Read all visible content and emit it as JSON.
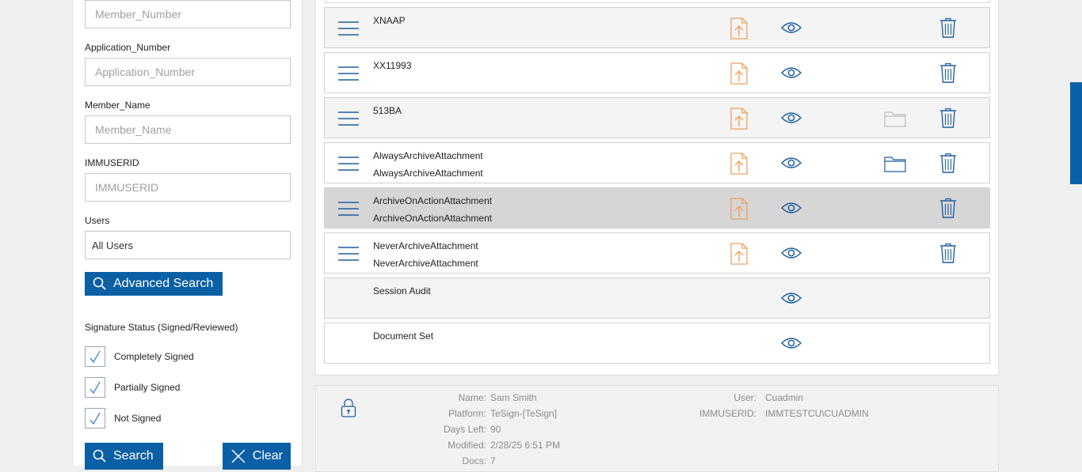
{
  "filters": {
    "member_number": {
      "placeholder": "Member_Number"
    },
    "application_number": {
      "label": "Application_Number",
      "placeholder": "Application_Number"
    },
    "member_name": {
      "label": "Member_Name",
      "placeholder": "Member_Name"
    },
    "immuserid": {
      "label": "IMMUSERID",
      "placeholder": "IMMUSERID"
    },
    "users": {
      "label": "Users",
      "value": "All Users"
    },
    "advanced_search_label": "Advanced Search",
    "signature_status": {
      "title": "Signature Status (Signed/Reviewed)",
      "options": [
        {
          "label": "Completely Signed",
          "checked": true
        },
        {
          "label": "Partially Signed",
          "checked": true
        },
        {
          "label": "Not Signed",
          "checked": true
        }
      ]
    },
    "search_label": "Search",
    "clear_label": "Clear"
  },
  "documents": [
    {
      "line1": "XNAAP",
      "line2": "",
      "menu": true,
      "upload": true,
      "view": true,
      "folder": false,
      "folder_active": false,
      "delete": true,
      "state": "alt"
    },
    {
      "line1": "XX11993",
      "line2": "",
      "menu": true,
      "upload": true,
      "view": true,
      "folder": false,
      "folder_active": false,
      "delete": true,
      "state": "normal"
    },
    {
      "line1": "513BA",
      "line2": "",
      "menu": true,
      "upload": true,
      "view": true,
      "folder": true,
      "folder_active": false,
      "delete": true,
      "state": "alt"
    },
    {
      "line1": "AlwaysArchiveAttachment",
      "line2": "AlwaysArchiveAttachment",
      "menu": true,
      "upload": true,
      "view": true,
      "folder": true,
      "folder_active": true,
      "delete": true,
      "state": "normal"
    },
    {
      "line1": "ArchiveOnActionAttachment",
      "line2": "ArchiveOnActionAttachment",
      "menu": true,
      "upload": true,
      "view": true,
      "folder": false,
      "folder_active": false,
      "delete": true,
      "state": "selected"
    },
    {
      "line1": "NeverArchiveAttachment",
      "line2": "NeverArchiveAttachment",
      "menu": true,
      "upload": true,
      "view": true,
      "folder": false,
      "folder_active": false,
      "delete": true,
      "state": "normal"
    },
    {
      "line1": "Session Audit",
      "line2": "",
      "menu": false,
      "upload": false,
      "view": true,
      "folder": false,
      "folder_active": false,
      "delete": false,
      "state": "alt"
    },
    {
      "line1": "Document Set",
      "line2": "",
      "menu": false,
      "upload": false,
      "view": true,
      "folder": false,
      "folder_active": false,
      "delete": false,
      "state": "normal"
    }
  ],
  "info": {
    "left": [
      {
        "key": "Name:",
        "value": "Sam Smith"
      },
      {
        "key": "Platform:",
        "value": "TeSign-[TeSign]"
      },
      {
        "key": "Days Left:",
        "value": "90"
      },
      {
        "key": "Modified:",
        "value": "2/28/25 6:51 PM"
      },
      {
        "key": "Docs:",
        "value": "7"
      }
    ],
    "right": [
      {
        "key": "User:",
        "value": "Cuadmin"
      },
      {
        "key": "IMMUSERID:",
        "value": "IMMTESTCU\\CUADMIN"
      }
    ]
  },
  "colors": {
    "accent": "#0b5fa5",
    "upload": "#f0a060",
    "icon_blue": "#1f5f9e",
    "selected_row": "#d6d6d6"
  }
}
